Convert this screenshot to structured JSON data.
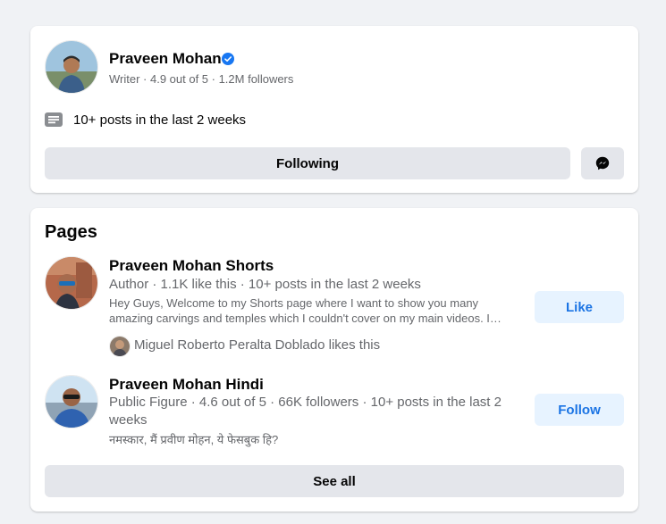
{
  "profile": {
    "name": "Praveen Mohan",
    "verified_icon": "verified-badge-icon",
    "subtitle": "Writer · 4.9 out of 5 · 1.2M followers",
    "posts_info": "10+ posts in the last 2 weeks",
    "following_label": "Following",
    "messenger_icon": "messenger-icon"
  },
  "pages": {
    "title": "Pages",
    "items": [
      {
        "name": "Praveen Mohan Shorts",
        "meta": "Author · 1.1K like this · 10+ posts in the last 2 weeks",
        "description": "Hey Guys, Welcome to my Shorts page where I want to show you many amazing carvings and temples which I couldn't cover on my main videos. I…",
        "mutual": "Miguel Roberto Peralta Doblado likes this",
        "action_label": "Like"
      },
      {
        "name": "Praveen Mohan Hindi",
        "meta": "Public Figure · 4.6 out of 5 · 66K followers · 10+ posts in the last 2 weeks",
        "description": "नमस्कार, मैं प्रवीण मोहन, ये फेसबुक हि?",
        "action_label": "Follow"
      }
    ],
    "see_all_label": "See all"
  },
  "colors": {
    "page_bg": "#f0f2f5",
    "card_bg": "#ffffff",
    "accent_blue": "#1b74e4",
    "button_gray": "#e4e6eb",
    "button_blue_bg": "#e7f3ff",
    "secondary_text": "#65676b"
  }
}
